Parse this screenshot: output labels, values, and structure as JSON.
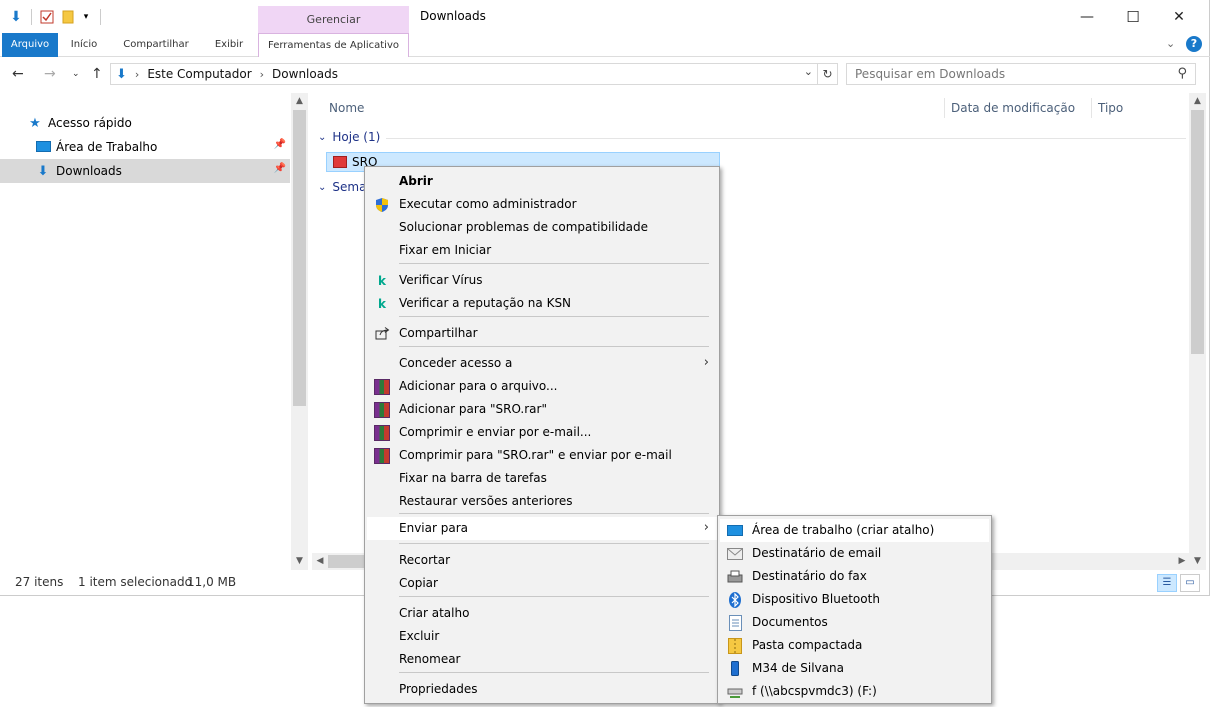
{
  "window": {
    "title": "Downloads",
    "manage_tab": "Gerenciar",
    "controls": {
      "minimize": "—",
      "maximize": "☐",
      "close": "✕"
    }
  },
  "ribbon": {
    "tabs": [
      "Arquivo",
      "Início",
      "Compartilhar",
      "Exibir",
      "Ferramentas de Aplicativo"
    ]
  },
  "address": {
    "crumbs": [
      "Este Computador",
      "Downloads"
    ],
    "search_placeholder": "Pesquisar em Downloads"
  },
  "nav": {
    "quick_access": "Acesso rápido",
    "items": [
      "Área de Trabalho",
      "Downloads"
    ]
  },
  "columns": {
    "name": "Nome",
    "date": "Data de modificação",
    "type": "Tipo"
  },
  "groups": {
    "today": "Hoje (1)",
    "week": "Sema"
  },
  "file": {
    "name": "SRO"
  },
  "status": {
    "count": "27 itens",
    "selected": "1 item selecionado",
    "size": "11,0 MB"
  },
  "context_menu": {
    "items": [
      {
        "label": "Abrir",
        "bold": true,
        "icon": ""
      },
      {
        "label": "Executar como administrador",
        "icon": "shield-icon"
      },
      {
        "label": "Solucionar problemas de compatibilidade",
        "icon": ""
      },
      {
        "label": "Fixar em Iniciar",
        "icon": ""
      },
      {
        "label": "Verificar Vírus",
        "icon": "kaspersky-icon"
      },
      {
        "label": "Verificar a reputação na KSN",
        "icon": "kaspersky-icon"
      },
      {
        "label": "Compartilhar",
        "icon": "share-icon"
      },
      {
        "label": "Conceder acesso a",
        "icon": "",
        "submenu": true
      },
      {
        "label": "Adicionar para o arquivo...",
        "icon": "winrar-icon"
      },
      {
        "label": "Adicionar para \"SRO.rar\"",
        "icon": "winrar-icon"
      },
      {
        "label": "Comprimir e enviar por e-mail...",
        "icon": "winrar-icon"
      },
      {
        "label": "Comprimir para \"SRO.rar\" e enviar por e-mail",
        "icon": "winrar-icon"
      },
      {
        "label": "Fixar na barra de tarefas",
        "icon": ""
      },
      {
        "label": "Restaurar versões anteriores",
        "icon": ""
      },
      {
        "label": "Enviar para",
        "icon": "",
        "submenu": true
      },
      {
        "label": "Recortar",
        "icon": ""
      },
      {
        "label": "Copiar",
        "icon": ""
      },
      {
        "label": "Criar atalho",
        "icon": ""
      },
      {
        "label": "Excluir",
        "icon": ""
      },
      {
        "label": "Renomear",
        "icon": ""
      },
      {
        "label": "Propriedades",
        "icon": ""
      }
    ]
  },
  "send_to_menu": {
    "items": [
      {
        "label": "Área de trabalho (criar atalho)",
        "icon": "desktop-icon"
      },
      {
        "label": "Destinatário de email",
        "icon": "mail-icon"
      },
      {
        "label": "Destinatário do fax",
        "icon": "fax-icon"
      },
      {
        "label": "Dispositivo Bluetooth",
        "icon": "bluetooth-icon"
      },
      {
        "label": "Documentos",
        "icon": "documents-icon"
      },
      {
        "label": "Pasta compactada",
        "icon": "zip-folder-icon"
      },
      {
        "label": "M34 de Silvana",
        "icon": "phone-icon"
      },
      {
        "label": "f (\\\\abcspvmdc3) (F:)",
        "icon": "network-drive-icon"
      }
    ]
  }
}
